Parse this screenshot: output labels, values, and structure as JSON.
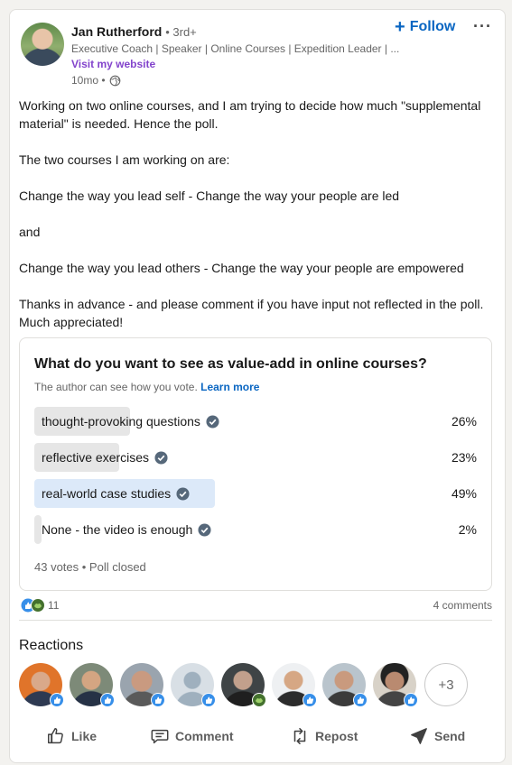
{
  "author": {
    "name": "Jan Rutherford",
    "degree": "• 3rd+",
    "headline": "Executive Coach | Speaker | Online Courses | Expedition Leader | ...",
    "website_link": "Visit my website",
    "time": "10mo •"
  },
  "header": {
    "follow_label": "Follow",
    "more_label": "···"
  },
  "post": {
    "lines": [
      "Working on two online courses, and I am trying to decide how much \"supplemental material\" is needed. Hence the poll.",
      "The two courses I am working on are:",
      "Change the way you lead self - Change the way your people are led",
      "and",
      "Change the way you lead others - Change the way your people are empowered",
      "Thanks in advance - and please comment if you have input not reflected in the poll. Much appreciated!"
    ]
  },
  "poll": {
    "question": "What do you want to see as value-add in online courses?",
    "note": "The author can see how you vote.",
    "learn_more": "Learn more",
    "options": [
      {
        "label": "thought-provoking questions",
        "percent_text": "26%",
        "percent": 26,
        "selected": false
      },
      {
        "label": "reflective exercises",
        "percent_text": "23%",
        "percent": 23,
        "selected": false
      },
      {
        "label": "real-world case studies",
        "percent_text": "49%",
        "percent": 49,
        "selected": true
      },
      {
        "label": "None - the video is enough",
        "percent_text": "2%",
        "percent": 2,
        "selected": false
      }
    ],
    "meta": "43 votes • Poll closed"
  },
  "social": {
    "reaction_count": "11",
    "comments": "4 comments"
  },
  "reactions": {
    "title": "Reactions",
    "more": "+3",
    "avatars": [
      {
        "name": "reactor-1",
        "reaction": "like"
      },
      {
        "name": "reactor-2",
        "reaction": "like"
      },
      {
        "name": "reactor-3",
        "reaction": "like"
      },
      {
        "name": "reactor-4",
        "reaction": "like"
      },
      {
        "name": "reactor-5",
        "reaction": "support"
      },
      {
        "name": "reactor-6",
        "reaction": "like"
      },
      {
        "name": "reactor-7",
        "reaction": "like"
      },
      {
        "name": "reactor-8",
        "reaction": "like"
      }
    ]
  },
  "actions": {
    "like": "Like",
    "comment": "Comment",
    "repost": "Repost",
    "send": "Send"
  },
  "colors": {
    "accent": "#0a66c2",
    "website": "#8344cc",
    "selected_fill": "#dce9f9",
    "option_fill": "#e6e6e6"
  }
}
